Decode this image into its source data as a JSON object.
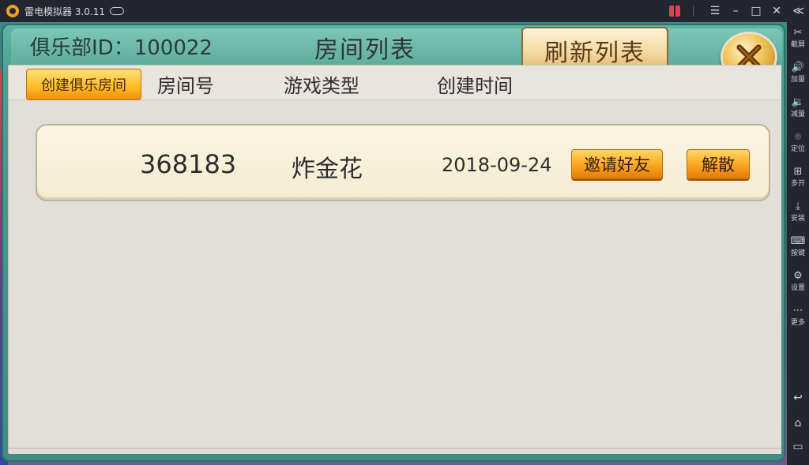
{
  "titlebar": {
    "app_title": "雷电模拟器 3.0.11",
    "buttons": {
      "menu": "☰",
      "minimize": "–",
      "maximize": "□",
      "close": "✕",
      "collapse": "≪"
    }
  },
  "sidebar": {
    "items": [
      {
        "icon": "scissors-icon",
        "glyph": "✂",
        "label": "截屏"
      },
      {
        "icon": "volume-up-icon",
        "glyph": "🔊",
        "label": "加量"
      },
      {
        "icon": "volume-down-icon",
        "glyph": "🔉",
        "label": "减量"
      },
      {
        "icon": "location-icon",
        "glyph": "⌾",
        "label": "定位"
      },
      {
        "icon": "multi-open-icon",
        "glyph": "⊞",
        "label": "多开"
      },
      {
        "icon": "install-apk-icon",
        "glyph": "⤓",
        "label": "安装"
      },
      {
        "icon": "keyboard-icon",
        "glyph": "⌨",
        "label": "按键"
      },
      {
        "icon": "settings-icon",
        "glyph": "⚙",
        "label": "设置"
      },
      {
        "icon": "more-icon",
        "glyph": "⋯",
        "label": "更多"
      }
    ],
    "nav": {
      "back": "↩",
      "home": "⌂",
      "recent": "▭"
    }
  },
  "game": {
    "club_id": "俱乐部ID：100022",
    "list_title": "房间列表",
    "refresh_label": "刷新列表",
    "create_room_label": "创建俱乐房间",
    "columns": {
      "room_no": "房间号",
      "game_type": "游戏类型",
      "created_time": "创建时间"
    },
    "rooms": [
      {
        "room_no": "368183",
        "game_type": "炸金花",
        "created_time": "2018-09-24",
        "invite_label": "邀请好友",
        "disband_label": "解散"
      }
    ]
  }
}
